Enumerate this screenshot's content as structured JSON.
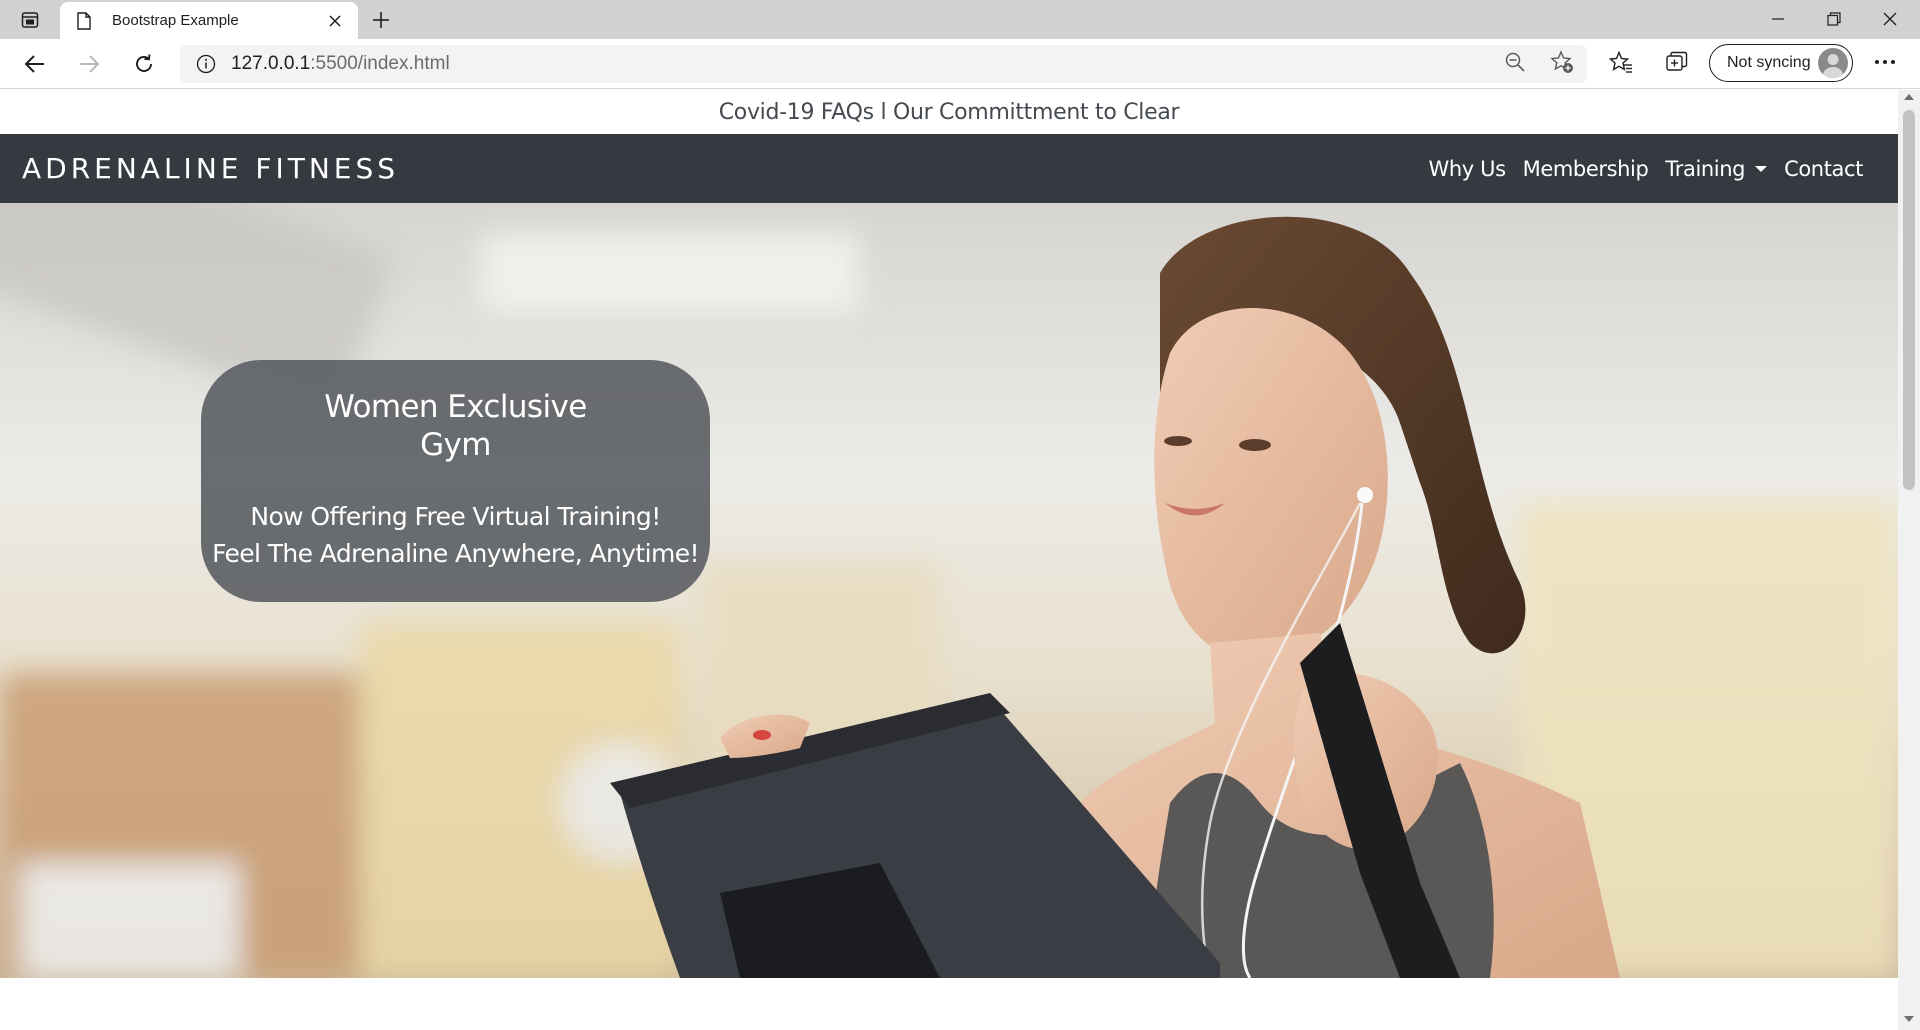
{
  "browser": {
    "tab_title": "Bootstrap Example",
    "url_host": "127.0.0.1",
    "url_rest": ":5500/index.html",
    "sync_label": "Not syncing"
  },
  "page": {
    "announcement": "Covid-19 FAQs l Our Committment to Clear",
    "brand": "ADRENALINE FITNESS",
    "nav": {
      "why_us": "Why Us",
      "membership": "Membership",
      "training": "Training",
      "contact": "Contact"
    },
    "hero": {
      "title_line1": "Women Exclusive",
      "title_line2": "Gym",
      "tagline_line1": "Now Offering Free Virtual Training!",
      "tagline_line2": "Feel The Adrenaline Anywhere, Anytime!"
    }
  },
  "colors": {
    "navbar": "#343a40",
    "hero_card": "#5f6266",
    "tabbar": "#cfd1d3"
  }
}
